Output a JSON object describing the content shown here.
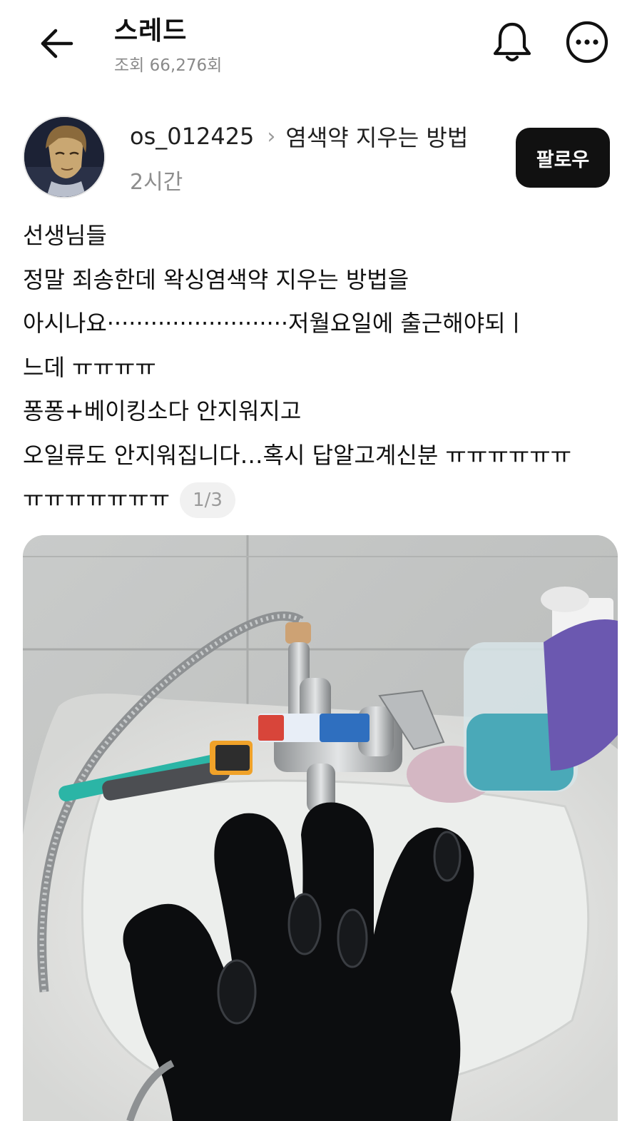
{
  "header": {
    "title": "스레드",
    "views": "조회 66,276회",
    "back_icon": "arrow-left-icon",
    "bell_icon": "bell-icon",
    "more_icon": "more-horizontal-icon"
  },
  "post": {
    "author": "os_012425",
    "topic": "염색약 지우는 방법",
    "time": "2시간",
    "follow_label": "팔로우",
    "lines": [
      "선생님들",
      "정말 죄송한데 왁싱염색약 지우는 방법을",
      "아시나요·························저월요일에 출근해야되ㅣ",
      "느데 ㅠㅠㅠㅠ",
      "퐁퐁+베이킹소다 안지워지고",
      "오일류도 안지워집니다…혹시 답알고계신분 ㅠㅠㅠㅠㅠㅠ",
      "ㅠㅠㅠㅠㅠㅠㅠ"
    ],
    "page_indicator": "1/3"
  },
  "colors": {
    "text": "#111111",
    "muted": "#8a8a8a",
    "button_bg": "#111111",
    "button_text": "#ffffff",
    "indicator_bg": "#f1f1f1"
  }
}
